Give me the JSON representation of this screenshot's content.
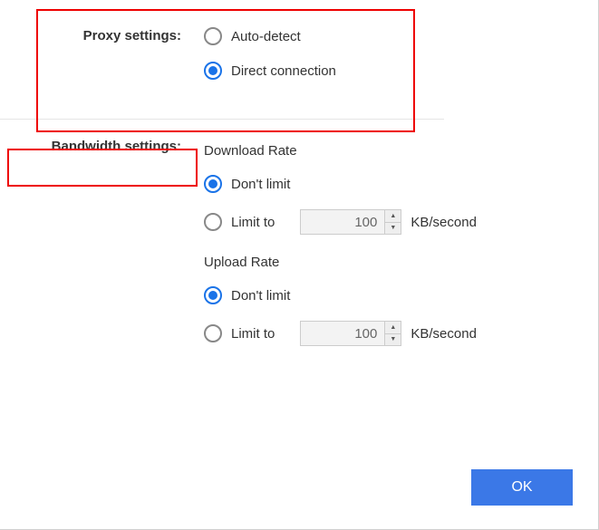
{
  "proxy": {
    "label": "Proxy settings:",
    "auto_detect": "Auto-detect",
    "direct": "Direct connection",
    "selected": "direct"
  },
  "bandwidth": {
    "label": "Bandwidth settings:",
    "download": {
      "heading": "Download Rate",
      "dont_limit": "Don't limit",
      "limit_to": "Limit to",
      "value": "100",
      "unit": "KB/second",
      "selected": "dont_limit"
    },
    "upload": {
      "heading": "Upload Rate",
      "dont_limit": "Don't limit",
      "limit_to": "Limit to",
      "value": "100",
      "unit": "KB/second",
      "selected": "dont_limit"
    }
  },
  "ok_label": "OK"
}
